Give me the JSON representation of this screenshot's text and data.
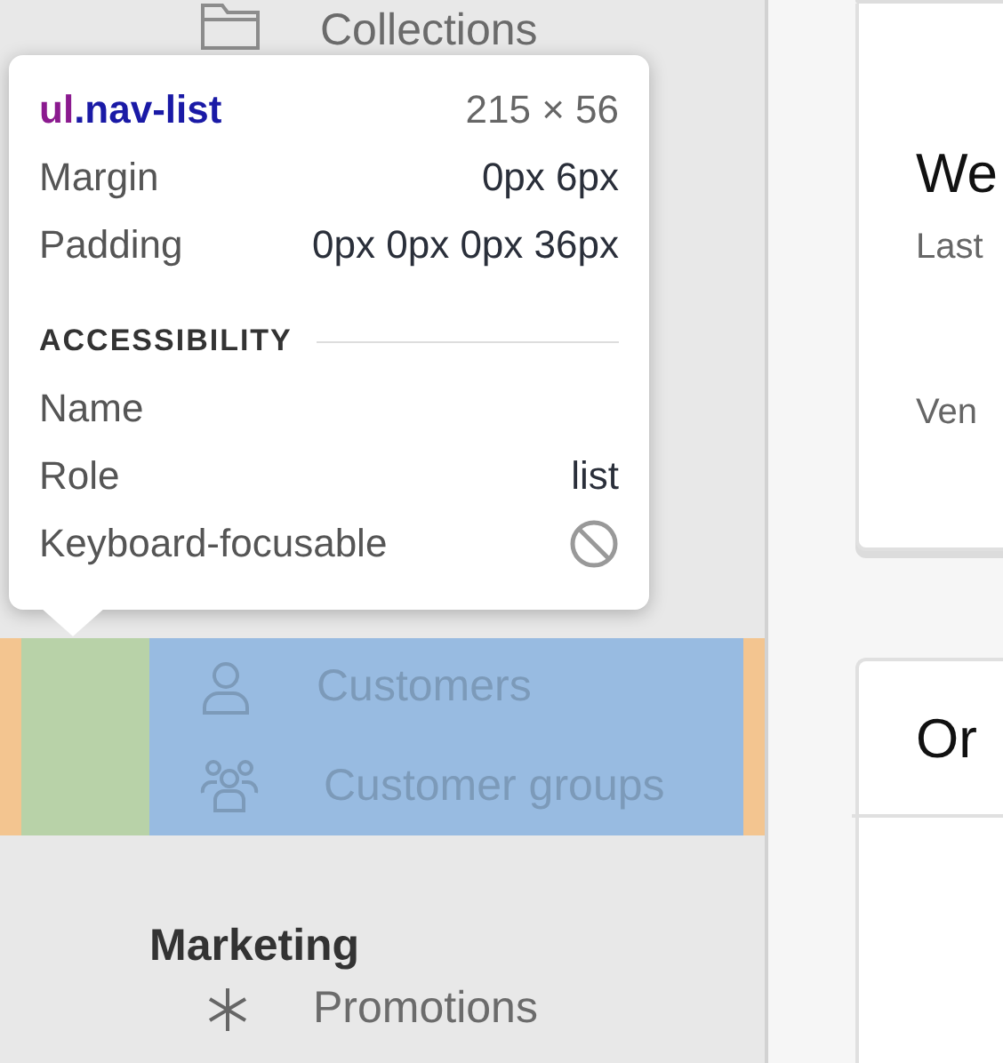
{
  "sidebar": {
    "top_item": {
      "label": "Collections"
    },
    "nav_list": {
      "items": [
        {
          "label": "Customers"
        },
        {
          "label": "Customer groups"
        }
      ]
    },
    "sections": [
      {
        "heading": "Marketing",
        "items": [
          {
            "label": "Promotions"
          }
        ]
      }
    ]
  },
  "inspector": {
    "tag": "ul",
    "class_name": ".nav-list",
    "size": "215 × 56",
    "box_rows": [
      {
        "label": "Margin",
        "value": "0px 6px"
      },
      {
        "label": "Padding",
        "value": "0px 0px 0px 36px"
      }
    ],
    "section_title": "ACCESSIBILITY",
    "accessibility": [
      {
        "label": "Name"
      },
      {
        "label": "Role",
        "value": "list"
      },
      {
        "label": "Keyboard-focusable",
        "focusable": false
      }
    ]
  },
  "cards": [
    {
      "title": "We",
      "lines": [
        "Last",
        "Ven"
      ]
    },
    {
      "title": "Or"
    }
  ]
}
